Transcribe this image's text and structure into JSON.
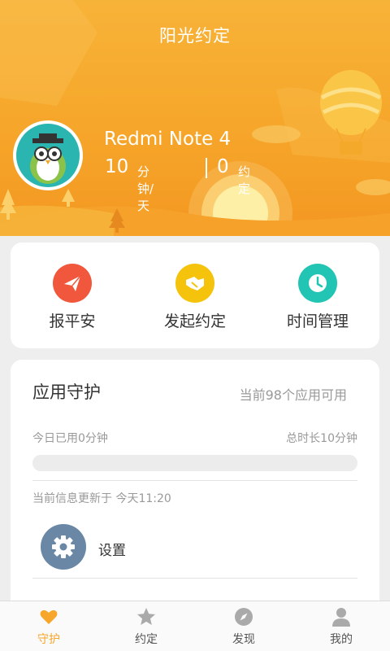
{
  "header": {
    "title": "阳光约定",
    "device_name": "Redmi Note 4",
    "minutes_per_day": "10",
    "minutes_unit": "分钟/天",
    "appointments_count": "0",
    "appointments_unit": "约定"
  },
  "actions": [
    {
      "label": "报平安",
      "icon": "paper-plane-icon",
      "color": "#f0573c"
    },
    {
      "label": "发起约定",
      "icon": "handshake-icon",
      "color": "#f5c20c"
    },
    {
      "label": "时间管理",
      "icon": "clock-icon",
      "color": "#22c5b4"
    }
  ],
  "guard": {
    "title": "应用守护",
    "available_apps": "当前98个应用可用",
    "used_today": "今日已用0分钟",
    "total_duration": "总时长10分钟",
    "progress_fraction": 0,
    "updated_at": "当前信息更新于 今天11:20",
    "settings_label": "设置",
    "settings_icon": "gear-icon"
  },
  "bottom_nav": {
    "items": [
      {
        "label": "守护",
        "icon": "heart-icon",
        "active": true
      },
      {
        "label": "约定",
        "icon": "star-icon",
        "active": false
      },
      {
        "label": "发现",
        "icon": "compass-icon",
        "active": false
      },
      {
        "label": "我的",
        "icon": "person-icon",
        "active": false
      }
    ]
  },
  "colors": {
    "brand_orange": "#f6a62a",
    "nav_inactive": "#aaaaaa",
    "settings_icon_bg": "#6a88a6"
  }
}
